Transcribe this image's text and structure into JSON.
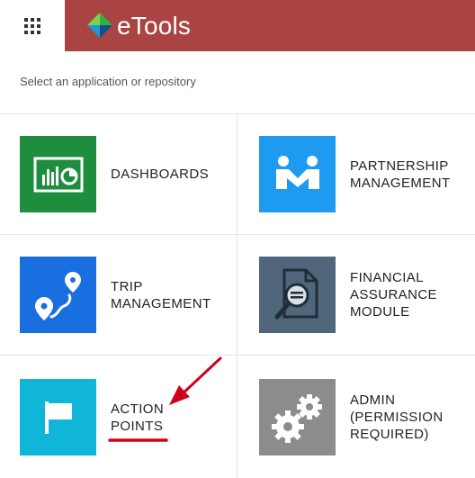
{
  "header": {
    "app_name": "eTools",
    "apps_menu_icon": "grid-icon",
    "bar_color": "#a94442"
  },
  "prompt": "Select an application or repository",
  "tiles": [
    {
      "label": "DASHBOARDS",
      "icon": "dashboard-icon",
      "color": "#1e8e3e"
    },
    {
      "label": "PARTNERSHIP\nMANAGEMENT",
      "icon": "handshake-icon",
      "color": "#1e9bf0"
    },
    {
      "label": "TRIP\nMANAGEMENT",
      "icon": "route-icon",
      "color": "#1a6fe0"
    },
    {
      "label": "FINANCIAL\nASSURANCE\nMODULE",
      "icon": "audit-document-icon",
      "color": "#50667a"
    },
    {
      "label": "ACTION\nPOINTS",
      "icon": "flag-icon",
      "color": "#10b6d8"
    },
    {
      "label": "ADMIN\n(PERMISSION\nREQUIRED)",
      "icon": "gears-icon",
      "color": "#8c8c8c"
    }
  ],
  "annotation": {
    "arrow_color": "#d0021b"
  }
}
